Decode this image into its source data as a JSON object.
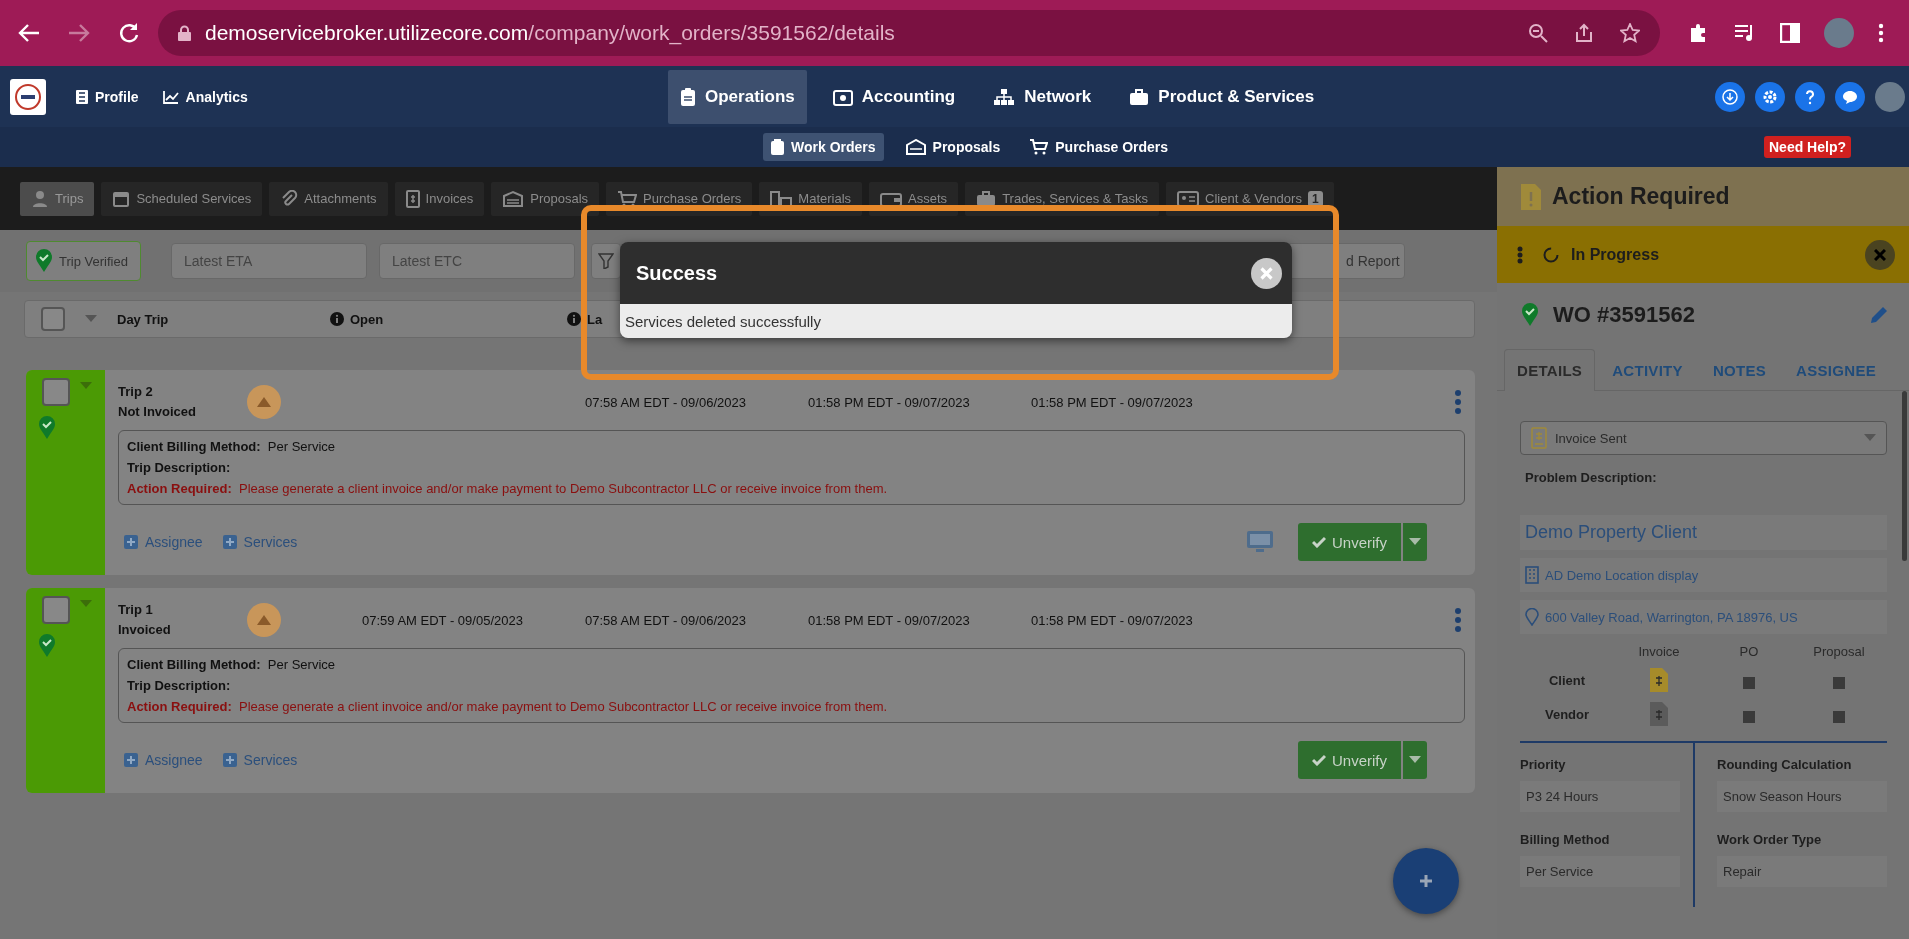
{
  "browser": {
    "url_host": "demoservicebroker.utilizecore.com",
    "url_path": "/company/work_orders/3591562/details",
    "forward_disabled": true
  },
  "navbar": {
    "left": [
      {
        "label": "Profile"
      },
      {
        "label": "Analytics"
      }
    ],
    "main": [
      {
        "label": "Operations",
        "selected": true
      },
      {
        "label": "Accounting",
        "selected": false
      },
      {
        "label": "Network",
        "selected": false
      },
      {
        "label": "Product & Services",
        "selected": false
      }
    ]
  },
  "subnav": {
    "items": [
      {
        "label": "Work Orders",
        "selected": true
      },
      {
        "label": "Proposals",
        "selected": false
      },
      {
        "label": "Purchase Orders",
        "selected": false
      }
    ],
    "help": "Need Help?"
  },
  "tabs": [
    {
      "label": "Trips",
      "selected": true
    },
    {
      "label": "Scheduled Services",
      "selected": false
    },
    {
      "label": "Attachments",
      "selected": false
    },
    {
      "label": "Invoices",
      "selected": false
    },
    {
      "label": "Proposals",
      "selected": false
    },
    {
      "label": "Purchase Orders",
      "selected": false
    },
    {
      "label": "Materials",
      "selected": false
    },
    {
      "label": "Assets",
      "selected": false
    },
    {
      "label": "Trades, Services & Tasks",
      "selected": false
    },
    {
      "label": "Client & Vendors",
      "selected": false,
      "badge": "1"
    }
  ],
  "filters": {
    "verified": "Trip Verified",
    "eta": {
      "placeholder": "Latest ETA"
    },
    "etc": {
      "placeholder": "Latest ETC"
    },
    "report_button": "d Report"
  },
  "list_header": {
    "checked": false,
    "day_trip": "Day Trip",
    "open": "Open",
    "column_3": "La"
  },
  "trips": [
    {
      "title": "Trip 2",
      "status": "Not Invoiced",
      "checked": false,
      "date_2": "07:58 AM EDT - 09/06/2023",
      "date_3": "01:58 PM EDT - 09/07/2023",
      "date_4": "01:58 PM EDT - 09/07/2023",
      "billing_label": "Client Billing Method:",
      "billing_value": "Per Service",
      "description_label": "Trip Description:",
      "action_label": "Action Required:",
      "action_text": "Please generate a client invoice and/or make payment to Demo Subcontractor LLC or receive invoice from them.",
      "links": [
        "Assignee",
        "Services"
      ],
      "monitor": true,
      "button": "Unverify"
    },
    {
      "title": "Trip 1",
      "status": "Invoiced",
      "checked": false,
      "date_1": "07:59 AM EDT - 09/05/2023",
      "date_2": "07:58 AM EDT - 09/06/2023",
      "date_3": "01:58 PM EDT - 09/07/2023",
      "date_4": "01:58 PM EDT - 09/07/2023",
      "billing_label": "Client Billing Method:",
      "billing_value": "Per Service",
      "description_label": "Trip Description:",
      "action_label": "Action Required:",
      "action_text": "Please generate a client invoice and/or make payment to Demo Subcontractor LLC or receive invoice from them.",
      "links": [
        "Assignee",
        "Services"
      ],
      "monitor": false,
      "button": "Unverify"
    }
  ],
  "modal": {
    "title": "Success",
    "message": "Services deleted successfully"
  },
  "panel": {
    "action_title": "Action Required",
    "status": "In Progress",
    "wo": "WO #3591562",
    "tabs": [
      {
        "label": "DETAILS",
        "selected": true
      },
      {
        "label": "ACTIVITY",
        "selected": false
      },
      {
        "label": "NOTES",
        "selected": false
      },
      {
        "label": "ASSIGNEE",
        "selected": false
      }
    ],
    "invoice_status": "Invoice Sent",
    "problem_label": "Problem Description:",
    "client": "Demo Property Client",
    "location": "AD Demo Location display",
    "address": "600 Valley Road, Warrington, PA 18976, US",
    "doc_columns": [
      "Invoice",
      "PO",
      "Proposal"
    ],
    "doc_rows": [
      {
        "label": "Client",
        "color": "#a68b2a"
      },
      {
        "label": "Vendor",
        "color": "#5b5b5b"
      }
    ],
    "fields": [
      {
        "label": "Priority",
        "value": "P3 24 Hours"
      },
      {
        "label": "Rounding Calculation",
        "value": "Snow Season Hours"
      },
      {
        "label": "Billing Method",
        "value": "Per Service"
      },
      {
        "label": "Work Order Type",
        "value": "Repair"
      }
    ]
  }
}
